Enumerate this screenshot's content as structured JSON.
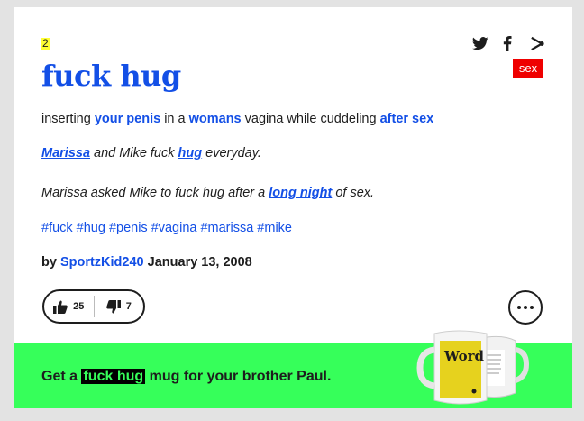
{
  "entry": {
    "rank": "2",
    "word": "fuck hug",
    "tag_badge": "sex",
    "meaning": [
      {
        "text": "inserting ",
        "link": false
      },
      {
        "text": "your penis",
        "link": true
      },
      {
        "text": " in a ",
        "link": false
      },
      {
        "text": "womans",
        "link": true
      },
      {
        "text": " vagina while cuddeling ",
        "link": false
      },
      {
        "text": "after sex",
        "link": true
      }
    ],
    "example1": [
      {
        "text": "Marissa",
        "link": true
      },
      {
        "text": " and Mike fuck ",
        "link": false
      },
      {
        "text": "hug",
        "link": true
      },
      {
        "text": " everyday.",
        "link": false
      }
    ],
    "example2": [
      {
        "text": "Marissa asked Mike to fuck hug after a ",
        "link": false
      },
      {
        "text": "long night",
        "link": true
      },
      {
        "text": " of sex.",
        "link": false
      }
    ],
    "hashtags": [
      "#fuck",
      "#hug",
      "#penis",
      "#vagina",
      "#marissa",
      "#mike"
    ],
    "contributor": {
      "by": "by",
      "author": "SportzKid240",
      "date": "January 13, 2008"
    },
    "votes": {
      "up": "25",
      "down": "7"
    }
  },
  "share": {
    "icons": [
      "twitter-icon",
      "facebook-icon",
      "share-icon"
    ]
  },
  "promo": {
    "prefix": "Get a",
    "word": "fuck hug",
    "suffix": "mug for your brother Paul.",
    "mug_label": "Word"
  },
  "colors": {
    "link": "#134fe6",
    "rank_highlight": "#ffff33",
    "badge": "#ef0000",
    "promo_bg": "#36ff5a"
  }
}
